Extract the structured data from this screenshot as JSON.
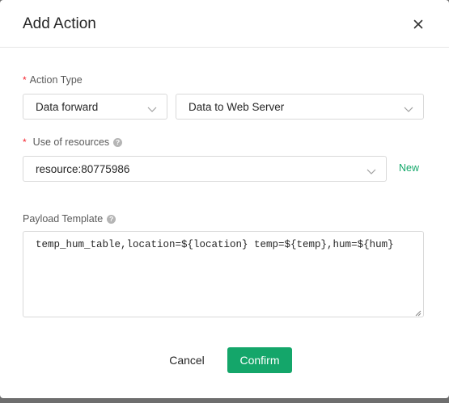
{
  "dialog": {
    "title": "Add Action",
    "close_icon": "close-icon"
  },
  "action_type": {
    "required_mark": "*",
    "label": "Action Type",
    "type_select": {
      "value": "Data forward"
    },
    "target_select": {
      "value": "Data to Web Server"
    }
  },
  "resources": {
    "required_mark": "*",
    "label": "Use of resources",
    "help_icon": "question-circle-icon",
    "select": {
      "value": "resource:80775986"
    },
    "new_label": "New"
  },
  "payload": {
    "label": "Payload Template",
    "help_icon": "question-circle-icon",
    "value": "temp_hum_table,location=${location} temp=${temp},hum=${hum}"
  },
  "footer": {
    "cancel_label": "Cancel",
    "confirm_label": "Confirm"
  },
  "colors": {
    "accent": "#14a66a",
    "required": "#f5222d"
  }
}
